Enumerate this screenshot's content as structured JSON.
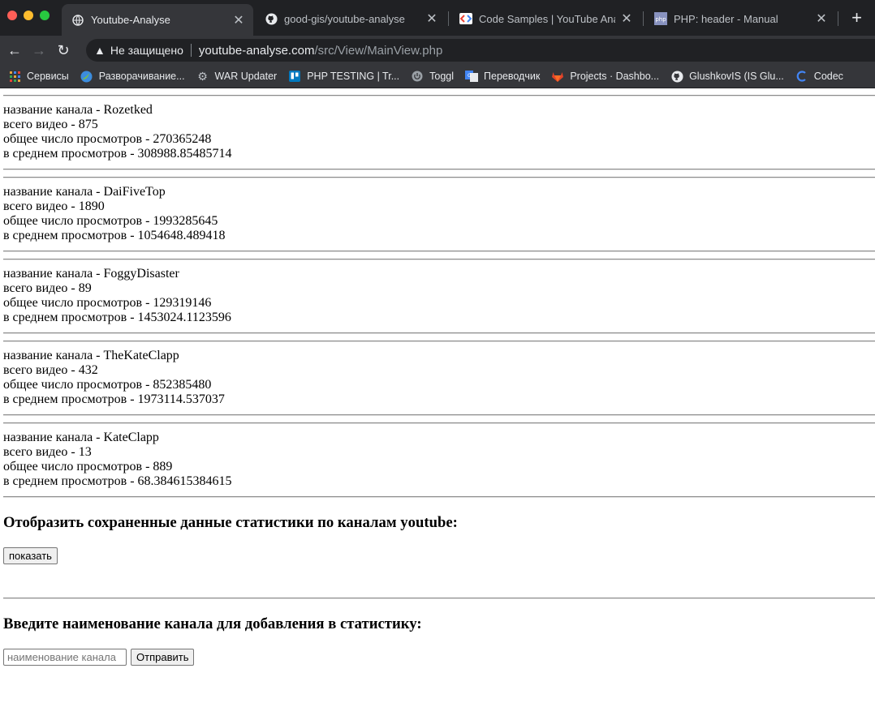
{
  "browser": {
    "tabs": [
      {
        "title": "Youtube-Analyse",
        "icon": "globe-icon",
        "active": true
      },
      {
        "title": "good-gis/youtube-analyse",
        "icon": "github-icon",
        "active": false
      },
      {
        "title": "Code Samples  |  YouTube Anal",
        "icon": "google-dev-icon",
        "active": false
      },
      {
        "title": "PHP: header - Manual",
        "icon": "php-icon",
        "active": false
      }
    ],
    "insecure_label": "Не защищено",
    "url_host": "youtube-analyse.com",
    "url_path": "/src/View/MainView.php",
    "bookmarks": [
      {
        "label": "Сервисы",
        "icon": "apps-grid-icon"
      },
      {
        "label": "Разворачивание...",
        "icon": "leaf-icon"
      },
      {
        "label": "WAR Updater",
        "icon": "gear-icon"
      },
      {
        "label": "PHP TESTING | Tr...",
        "icon": "trello-icon"
      },
      {
        "label": "Toggl",
        "icon": "power-icon"
      },
      {
        "label": "Переводчик",
        "icon": "translate-icon"
      },
      {
        "label": "Projects · Dashbo...",
        "icon": "gitlab-icon"
      },
      {
        "label": "GlushkovIS (IS Glu...",
        "icon": "github-icon"
      },
      {
        "label": "Codec",
        "icon": "codecov-icon"
      }
    ]
  },
  "channels": [
    {
      "name_line": "название канала - Rozetked",
      "videos_line": "всего видео - 875",
      "views_line": "общее число просмотров - 270365248",
      "avg_line": "в среднем просмотров - 308988.85485714"
    },
    {
      "name_line": "название канала - DaiFiveTop",
      "videos_line": "всего видео - 1890",
      "views_line": "общее число просмотров - 1993285645",
      "avg_line": "в среднем просмотров - 1054648.489418"
    },
    {
      "name_line": "название канала - FoggyDisaster",
      "videos_line": "всего видео - 89",
      "views_line": "общее число просмотров - 129319146",
      "avg_line": "в среднем просмотров - 1453024.1123596"
    },
    {
      "name_line": "название канала - TheKateClapp",
      "videos_line": "всего видео - 432",
      "views_line": "общее число просмотров - 852385480",
      "avg_line": "в среднем просмотров - 1973114.537037"
    },
    {
      "name_line": "название канала - KateClapp",
      "videos_line": "всего видео - 13",
      "views_line": "общее число просмотров - 889",
      "avg_line": "в среднем просмотров - 68.384615384615"
    }
  ],
  "show_section": {
    "heading": "Отобразить сохраненные данные статистики по каналам youtube:",
    "button_label": "показать"
  },
  "add_section": {
    "heading": "Введите наименование канала для добавления в статистику:",
    "input_placeholder": "наименование канала",
    "input_value": "",
    "submit_label": "Отправить"
  }
}
